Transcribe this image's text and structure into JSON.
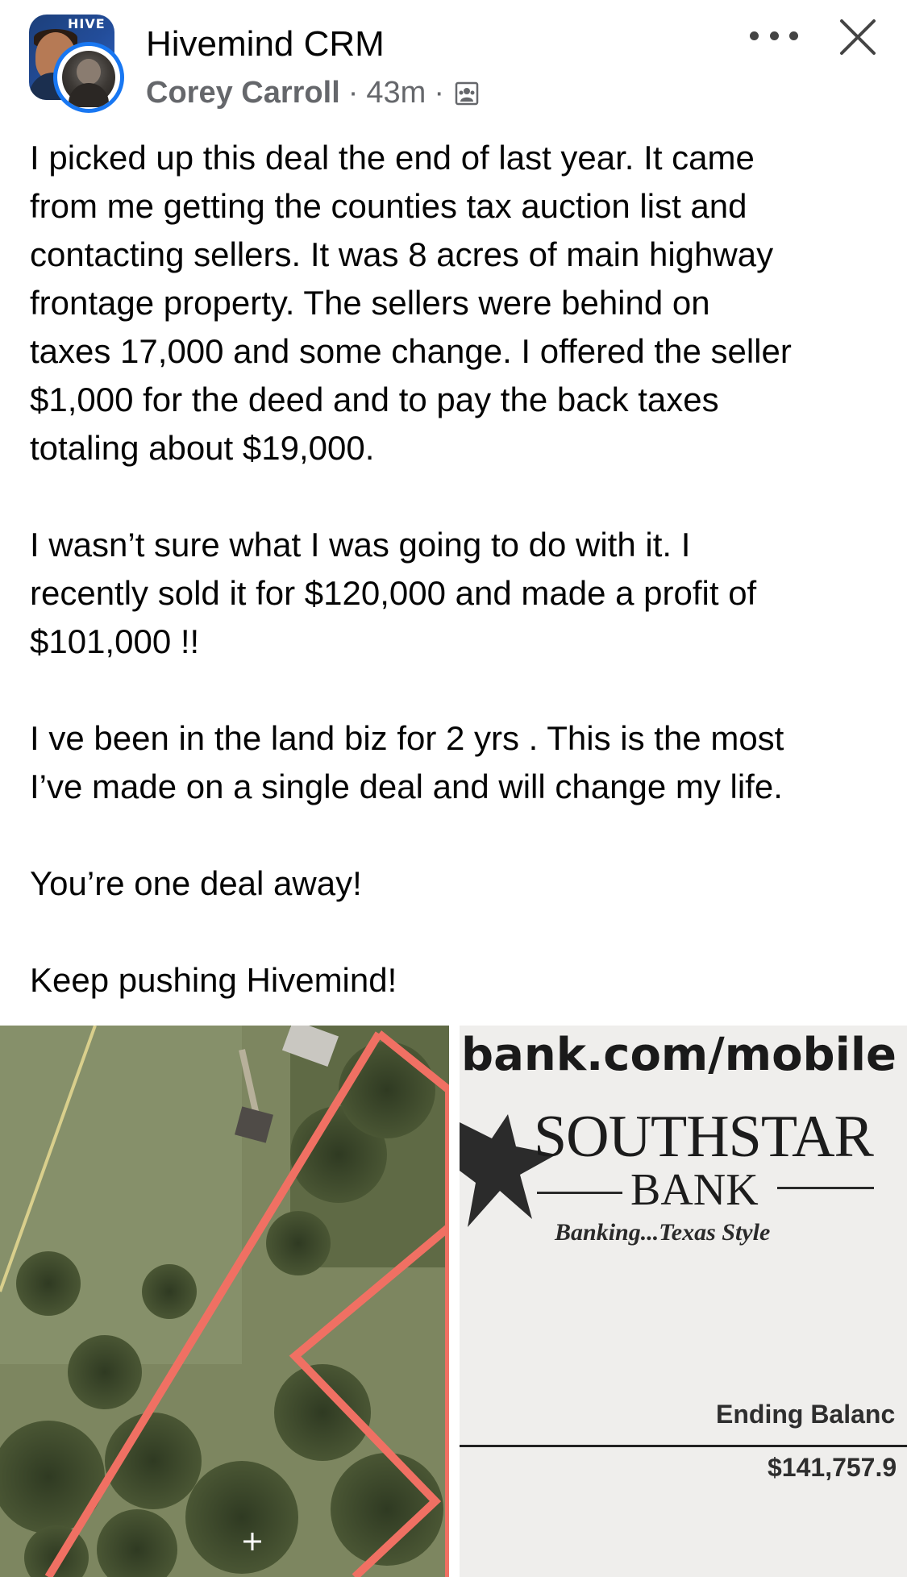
{
  "header": {
    "group_name": "Hivemind CRM",
    "group_avatar_text": "HIVE",
    "author": "Corey Carroll",
    "separator": "·",
    "time": "43m",
    "audience_icon": "group-photo-icon",
    "more_icon": "more-dots-icon",
    "close_icon": "close-icon"
  },
  "post": {
    "paragraphs": [
      "I picked up this deal the end of last year. It came\nfrom me getting the counties tax auction list and\ncontacting sellers.  It was 8 acres of main highway\nfrontage property. The sellers were behind on\ntaxes 17,000 and some change. I offered the seller\n$1,000 for the deed and to pay the back taxes\ntotaling about $19,000.",
      "I wasn’t sure what I was going to do with it. I\nrecently sold it for $120,000 and made a profit of\n$101,000 !!",
      "I ve been in the land biz for 2 yrs . This is the most\nI’ve made on a single deal and will change my life.",
      "You’re one deal away!",
      "Keep pushing Hivemind!"
    ]
  },
  "photos": {
    "left_alt": "aerial-map-photo",
    "right": {
      "url_text": "bank.com/mobile",
      "bank_name": "SOUTHSTAR",
      "bank_sub": "BANK",
      "tagline": "Banking...Texas Style",
      "ending_label": "Ending Balanc",
      "ending_value": "$141,757.9"
    }
  },
  "colors": {
    "accent": "#1877f2",
    "secondary_text": "#65676b",
    "parcel_outline": "#f07063"
  }
}
